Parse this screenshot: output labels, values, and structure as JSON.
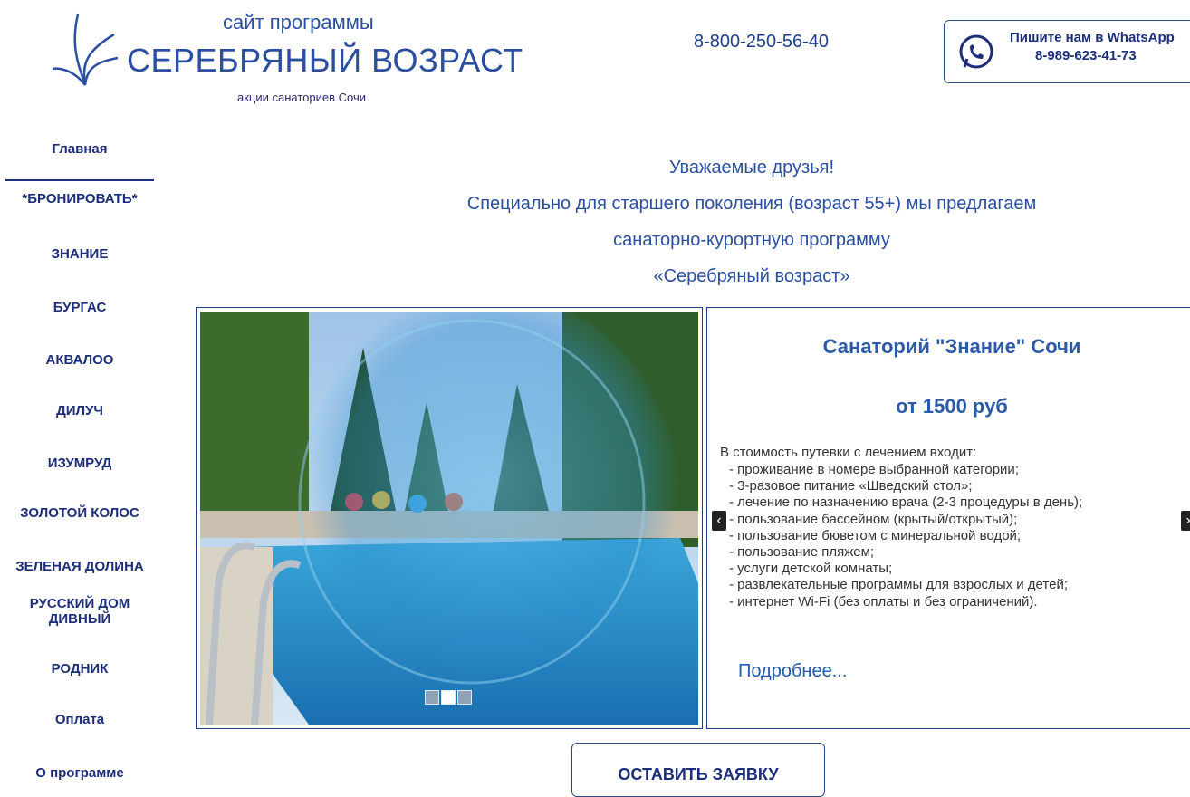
{
  "header": {
    "logo_subtitle": "сайт программы",
    "logo_title": "СЕРЕБРЯНЫЙ ВОЗРАСТ",
    "logo_tagline": "акции санаториев Сочи",
    "phone": "8-800-250-56-40",
    "whatsapp": {
      "line1": "Пишите нам в WhatsApp",
      "line2": "8-989-623-41-73",
      "icon": "whatsapp-icon"
    }
  },
  "nav": {
    "items": [
      {
        "label": "Главная",
        "active": true
      },
      {
        "label": "*БРОНИРОВАТЬ*"
      },
      {
        "label": "ЗНАНИЕ"
      },
      {
        "label": "БУРГАС"
      },
      {
        "label": "АКВАЛОО"
      },
      {
        "label": "ДИЛУЧ"
      },
      {
        "label": "ИЗУМРУД"
      },
      {
        "label": "ЗОЛОТОЙ КОЛОС"
      },
      {
        "label": "ЗЕЛЕНАЯ ДОЛИНА"
      },
      {
        "label": "РУССКИЙ ДОМ ДИВНЫЙ"
      },
      {
        "label": "РОДНИК"
      },
      {
        "label": "Оплата"
      },
      {
        "label": "О программе"
      }
    ]
  },
  "intro": {
    "lines": [
      "Уважаемые друзья!",
      "Специально для старшего поколения (возраст 55+) мы предлагаем",
      "санаторно-курортную программу",
      "«Серебряный возраст»"
    ]
  },
  "slide": {
    "title": "Санаторий \"Знание\" Сочи",
    "price": "от 1500 руб",
    "lead": "В стоимость путевки с лечением входит:",
    "list": [
      "- проживание в номере выбранной категории;",
      "- 3-разовое питание «Шведский стол»;",
      "- лечение по назначению врача (2-3 процедуры в день);",
      "- пользование бассейном (крытый/открытый);",
      "- пользование бюветом с минеральной водой;",
      "- пользование пляжем;",
      "- услуги детской комнаты;",
      "- развлекательные программы для взрослых и детей;",
      "- интернет Wi-Fi (без оплаты и без ограничений)."
    ],
    "more": "Подробнее...",
    "dots_total": 3,
    "dots_active": 2,
    "prev_icon": "chevron-left-icon",
    "next_icon": "chevron-right-icon"
  },
  "cta": {
    "label": "ОСТАВИТЬ ЗАЯВКУ"
  },
  "colors": {
    "brand": "#2a4ea0",
    "nav_text": "#1c2e7a",
    "border": "#1f3d8a"
  }
}
